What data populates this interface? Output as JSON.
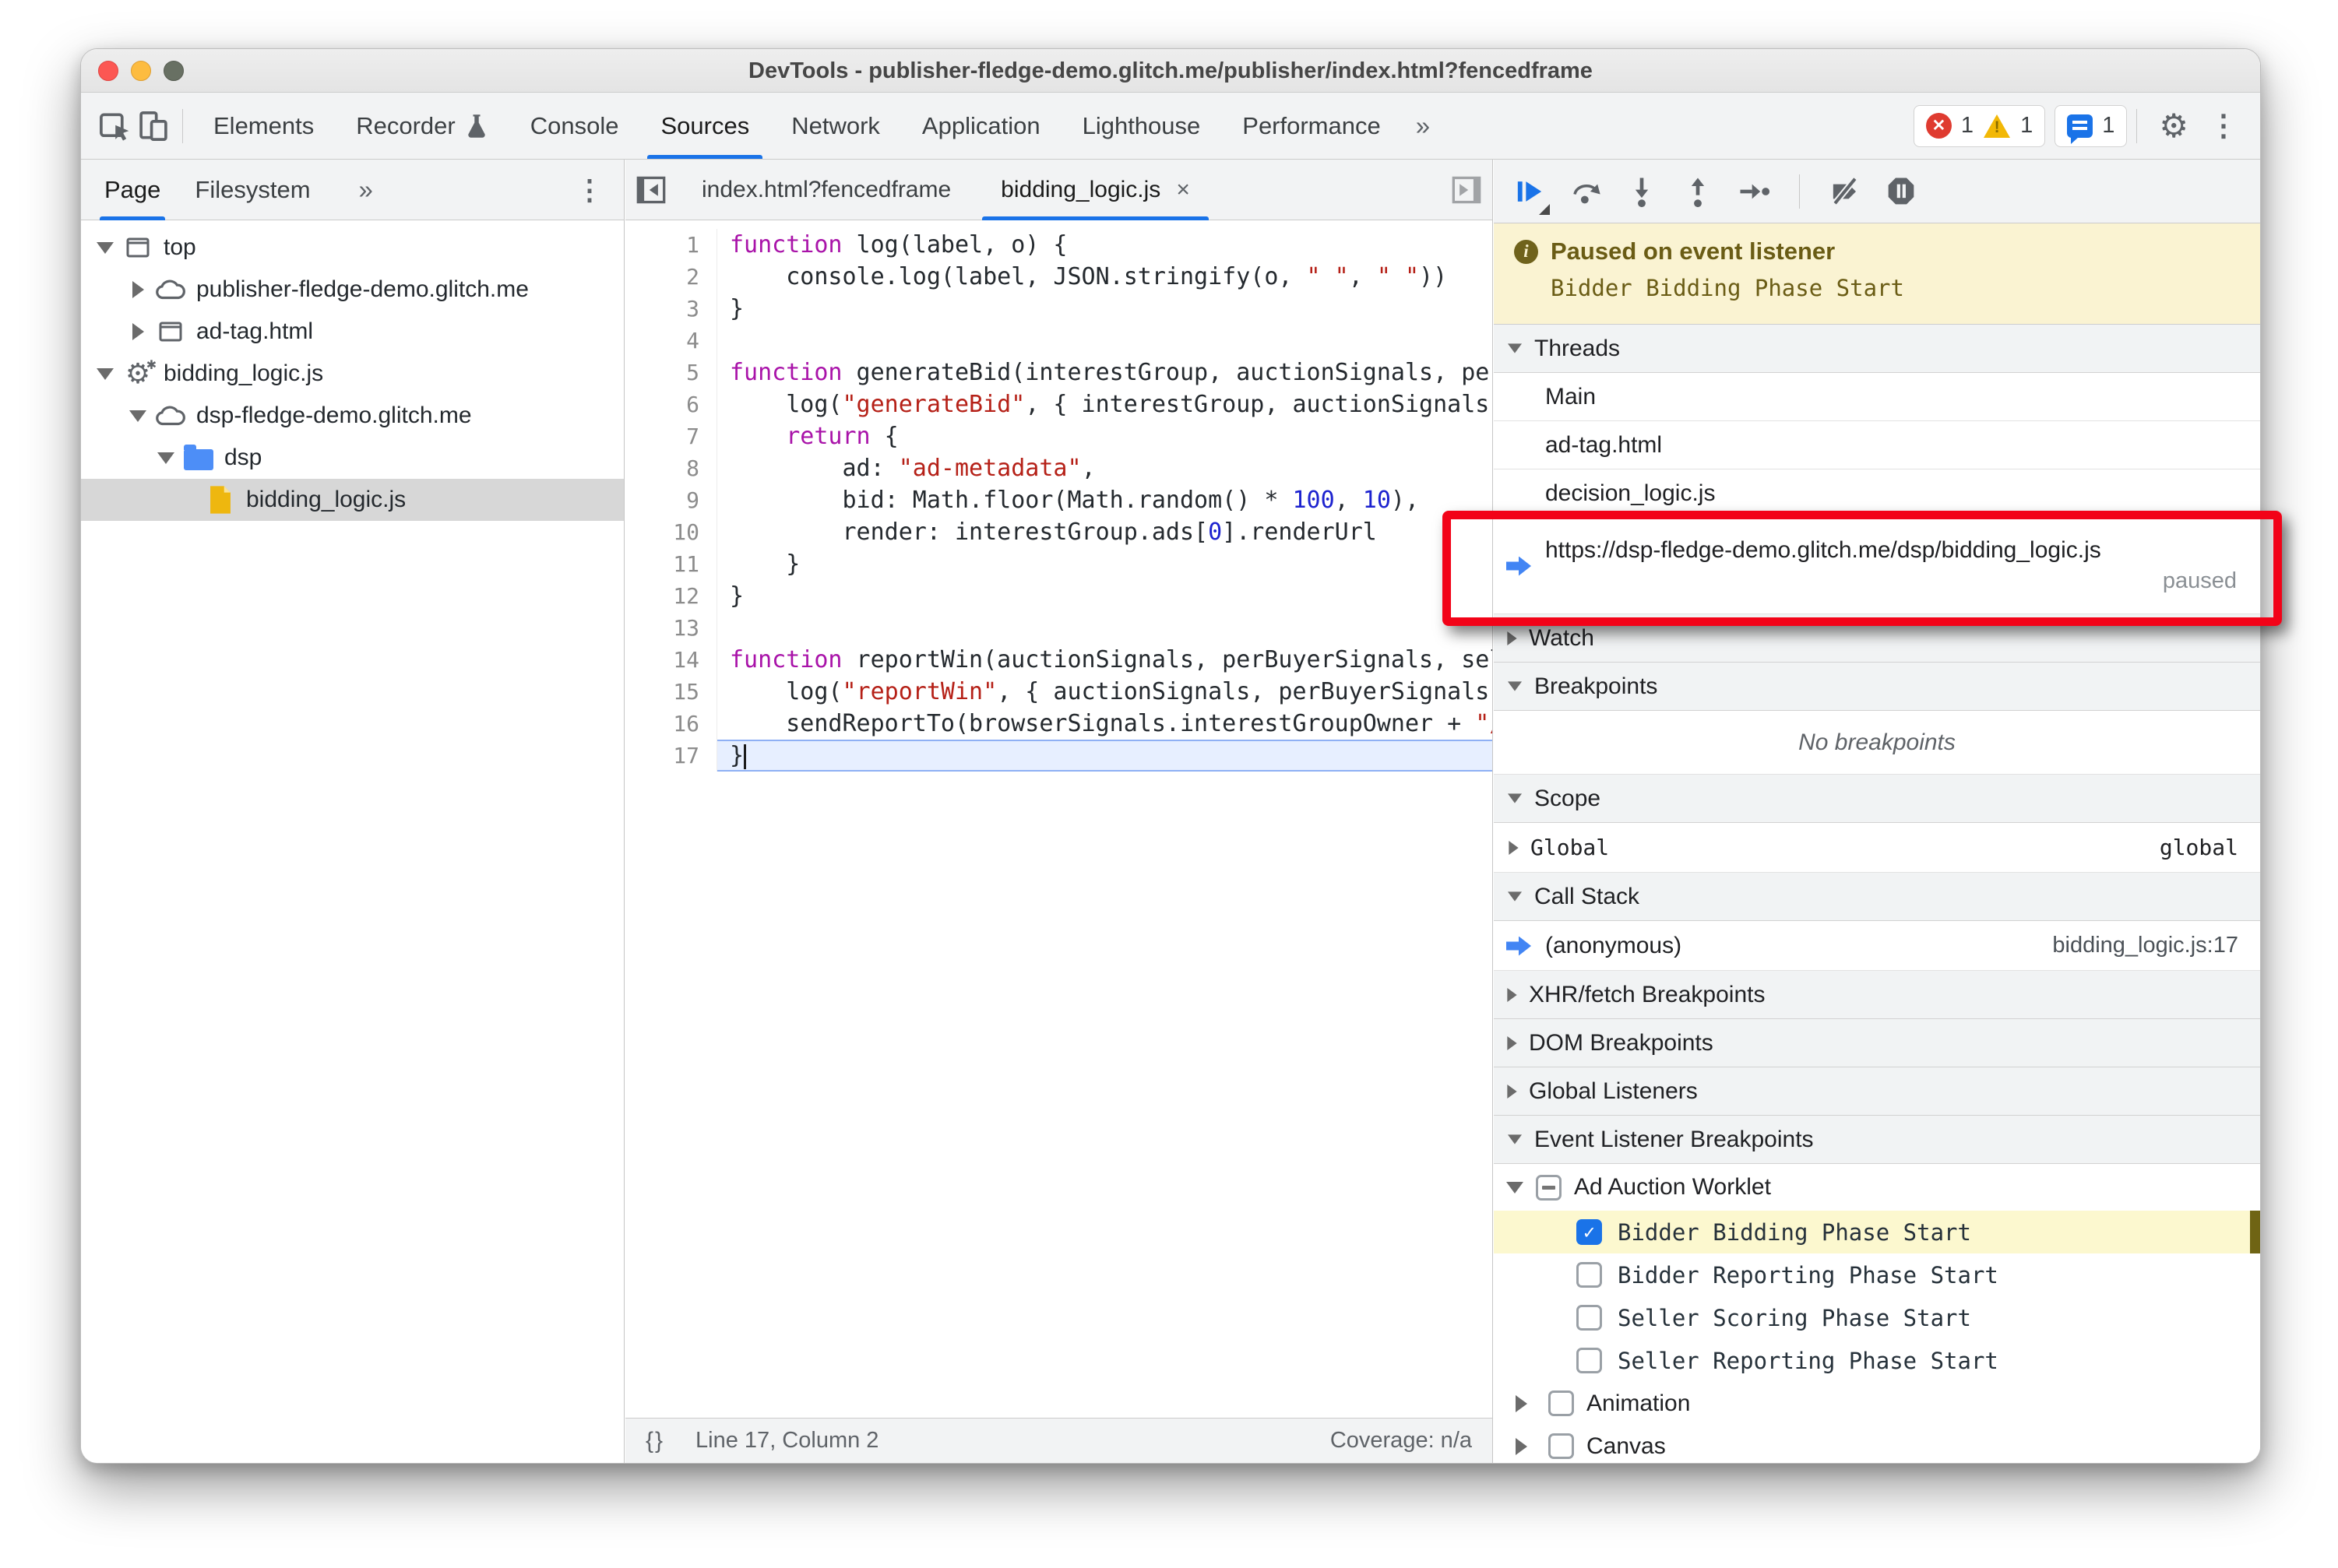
{
  "window": {
    "title": "DevTools - publisher-fledge-demo.glitch.me/publisher/index.html?fencedframe"
  },
  "icons": {
    "more": "»",
    "close": "×",
    "braces": "{}",
    "gear": "⚙",
    "kebab": "⋮"
  },
  "toolbar": {
    "tabs": [
      {
        "label": "Elements"
      },
      {
        "label": "Recorder",
        "icon": "flask-icon"
      },
      {
        "label": "Console"
      },
      {
        "label": "Sources",
        "selected": true
      },
      {
        "label": "Network"
      },
      {
        "label": "Application"
      },
      {
        "label": "Lighthouse"
      },
      {
        "label": "Performance"
      }
    ],
    "badges": {
      "errors": "1",
      "warnings": "1",
      "messages": "1"
    }
  },
  "sidebar": {
    "tabs": [
      {
        "label": "Page",
        "selected": true
      },
      {
        "label": "Filesystem"
      }
    ],
    "tree": [
      {
        "level": 0,
        "icon": "frame",
        "label": "top",
        "expander": "open"
      },
      {
        "level": 1,
        "icon": "cloud",
        "label": "publisher-fledge-demo.glitch.me",
        "expander": "closed"
      },
      {
        "level": 1,
        "icon": "frame",
        "label": "ad-tag.html",
        "expander": "closed"
      },
      {
        "level": 0,
        "icon": "worklet",
        "label": "bidding_logic.js",
        "expander": "open"
      },
      {
        "level": 1,
        "icon": "cloud",
        "label": "dsp-fledge-demo.glitch.me",
        "expander": "open"
      },
      {
        "level": 2,
        "icon": "folder",
        "label": "dsp",
        "expander": "open"
      },
      {
        "level": 3,
        "icon": "file",
        "label": "bidding_logic.js",
        "selected": true
      }
    ]
  },
  "editor": {
    "tabs": [
      {
        "label": "index.html?fencedframe"
      },
      {
        "label": "bidding_logic.js",
        "active": true,
        "closable": true
      }
    ],
    "active_line": 17,
    "lines": [
      [
        {
          "c": "k",
          "t": "function"
        },
        {
          "c": "d",
          "t": " log(label, o) {"
        }
      ],
      [
        {
          "c": "d",
          "t": "    console.log(label, JSON.stringify(o, "
        },
        {
          "c": "s",
          "t": "\" \""
        },
        {
          "c": "d",
          "t": ", "
        },
        {
          "c": "s",
          "t": "\" \""
        },
        {
          "c": "d",
          "t": "))"
        }
      ],
      [
        {
          "c": "d",
          "t": "}"
        }
      ],
      [],
      [
        {
          "c": "k",
          "t": "function"
        },
        {
          "c": "d",
          "t": " generateBid(interestGroup, auctionSignals, perBuyerSignals, trustedBiddingSignals, browserSignals) {"
        }
      ],
      [
        {
          "c": "d",
          "t": "    log("
        },
        {
          "c": "s",
          "t": "\"generateBid\""
        },
        {
          "c": "d",
          "t": ", { interestGroup, auctionSignals, perBuyerSignals, trustedBiddingSignals, browserSignals })"
        }
      ],
      [
        {
          "c": "d",
          "t": "    "
        },
        {
          "c": "k",
          "t": "return"
        },
        {
          "c": "d",
          "t": " {"
        }
      ],
      [
        {
          "c": "d",
          "t": "        ad: "
        },
        {
          "c": "s",
          "t": "\"ad-metadata\""
        },
        {
          "c": "d",
          "t": ","
        }
      ],
      [
        {
          "c": "d",
          "t": "        bid: Math.floor(Math.random() * "
        },
        {
          "c": "n",
          "t": "100"
        },
        {
          "c": "d",
          "t": ", "
        },
        {
          "c": "n",
          "t": "10"
        },
        {
          "c": "d",
          "t": "),"
        }
      ],
      [
        {
          "c": "d",
          "t": "        render: interestGroup.ads["
        },
        {
          "c": "n",
          "t": "0"
        },
        {
          "c": "d",
          "t": "].renderUrl"
        }
      ],
      [
        {
          "c": "d",
          "t": "    }"
        }
      ],
      [
        {
          "c": "d",
          "t": "}"
        }
      ],
      [],
      [
        {
          "c": "k",
          "t": "function"
        },
        {
          "c": "d",
          "t": " reportWin(auctionSignals, perBuyerSignals, sellerSignals, browserSignals) {"
        }
      ],
      [
        {
          "c": "d",
          "t": "    log("
        },
        {
          "c": "s",
          "t": "\"reportWin\""
        },
        {
          "c": "d",
          "t": ", { auctionSignals, perBuyerSignals, sellerSignals, browserSignals })"
        }
      ],
      [
        {
          "c": "d",
          "t": "    sendReportTo(browserSignals.interestGroupOwner + "
        },
        {
          "c": "s",
          "t": "\"/report/bidder\""
        },
        {
          "c": "d",
          "t": ")"
        }
      ],
      [
        {
          "c": "d",
          "t": "}"
        }
      ]
    ],
    "status": {
      "position": "Line 17, Column 2",
      "coverage": "Coverage: n/a"
    }
  },
  "dbg": {
    "paused_title": "Paused on event listener",
    "paused_detail": "Bidder Bidding Phase Start",
    "threads": {
      "title": "Threads",
      "items": [
        {
          "label": "Main"
        },
        {
          "label": "ad-tag.html"
        },
        {
          "label": "decision_logic.js"
        },
        {
          "label": "https://dsp-fledge-demo.glitch.me/dsp/bidding_logic.js",
          "status": "paused",
          "active": true
        }
      ]
    },
    "watch_title": "Watch",
    "breakpoints": {
      "title": "Breakpoints",
      "empty": "No breakpoints"
    },
    "scope": {
      "title": "Scope",
      "rows": [
        {
          "label": "Global",
          "value": "global"
        }
      ]
    },
    "call_stack": {
      "title": "Call Stack",
      "rows": [
        {
          "label": "(anonymous)",
          "location": "bidding_logic.js:17"
        }
      ]
    },
    "xhr_title": "XHR/fetch Breakpoints",
    "dom_title": "DOM Breakpoints",
    "global_listeners_title": "Global Listeners",
    "elb": {
      "title": "Event Listener Breakpoints",
      "group": {
        "label": "Ad Auction Worklet",
        "state": "indeterminate"
      },
      "items": [
        {
          "label": "Bidder Bidding Phase Start",
          "checked": true,
          "highlight": true
        },
        {
          "label": "Bidder Reporting Phase Start",
          "checked": false
        },
        {
          "label": "Seller Scoring Phase Start",
          "checked": false
        },
        {
          "label": "Seller Reporting Phase Start",
          "checked": false
        }
      ],
      "collapsed_groups": [
        {
          "label": "Animation"
        },
        {
          "label": "Canvas"
        }
      ]
    }
  },
  "colors": {
    "accent": "#1a73e8",
    "error": "#df3b30",
    "warning": "#f2b806",
    "paused_bg": "#faf3d2",
    "paused_fg": "#6a5c15",
    "highlight_row": "#fcf8cf",
    "annotation": "#f20318",
    "keyword": "#a913a9",
    "string": "#b52017",
    "number": "#1c22cf"
  }
}
